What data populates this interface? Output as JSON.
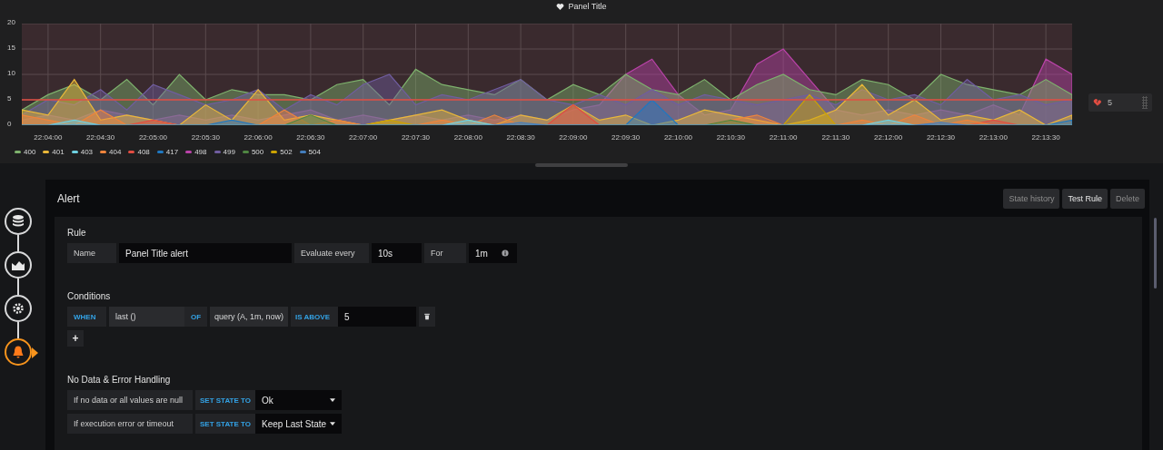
{
  "panel": {
    "title": "Panel Title",
    "chart_data": {
      "type": "area",
      "stacked": false,
      "grid": true,
      "legend": "bottom",
      "categories": [
        null,
        "22:04:00",
        null,
        "22:04:30",
        null,
        "22:05:00",
        null,
        "22:05:30",
        null,
        "22:06:00",
        null,
        "22:06:30",
        null,
        "22:07:00",
        null,
        "22:07:30",
        null,
        "22:08:00",
        null,
        "22:08:30",
        null,
        "22:09:00",
        null,
        "22:09:30",
        null,
        "22:10:00",
        null,
        "22:10:30",
        null,
        "22:11:00",
        null,
        "22:11:30",
        null,
        "22:12:00",
        null,
        "22:12:30",
        null,
        "22:13:00",
        null,
        "22:13:30",
        null
      ],
      "ylim": [
        0,
        20
      ],
      "yticks": [
        0,
        5,
        10,
        15,
        20
      ],
      "series": [
        {
          "name": "400",
          "color": "#7eb26d",
          "values": [
            3,
            6,
            8,
            5,
            9,
            4,
            10,
            5,
            7,
            6,
            6,
            5,
            8,
            9,
            4,
            11,
            8,
            7,
            6,
            9,
            5,
            8,
            6,
            10,
            7,
            6,
            9,
            5,
            8,
            10,
            7,
            6,
            9,
            8,
            5,
            10,
            8,
            7,
            6,
            9,
            6
          ]
        },
        {
          "name": "401",
          "color": "#eab839",
          "values": [
            3,
            2,
            9,
            1,
            2,
            1,
            0,
            4,
            1,
            7,
            1,
            2,
            1,
            0,
            1,
            2,
            3,
            1,
            0,
            2,
            1,
            4,
            1,
            2,
            0,
            1,
            3,
            2,
            1,
            0,
            1,
            3,
            8,
            2,
            5,
            1,
            2,
            1,
            3,
            0,
            2
          ]
        },
        {
          "name": "403",
          "color": "#6ed0e0",
          "values": [
            0,
            0,
            1,
            0,
            0,
            0,
            0,
            0,
            0,
            0,
            0,
            0,
            0,
            0,
            0,
            0,
            0,
            1,
            0,
            0,
            0,
            0,
            0,
            0,
            0,
            0,
            0,
            0,
            0,
            0,
            0,
            0,
            0,
            1,
            0,
            0,
            0,
            0,
            0,
            0,
            0
          ]
        },
        {
          "name": "404",
          "color": "#ef843c",
          "values": [
            2,
            1,
            0,
            3,
            0,
            0,
            0,
            0,
            0,
            0,
            3,
            0,
            1,
            0,
            0,
            0,
            1,
            0,
            2,
            0,
            0,
            0,
            0,
            0,
            0,
            0,
            0,
            1,
            2,
            0,
            0,
            0,
            1,
            0,
            2,
            0,
            1,
            0,
            0,
            0,
            0
          ]
        },
        {
          "name": "408",
          "color": "#e24d42",
          "values": [
            0,
            0,
            0,
            0,
            0,
            1,
            0,
            0,
            0,
            0,
            0,
            0,
            0,
            0,
            0,
            0,
            0,
            0,
            0,
            0,
            0,
            4,
            0,
            0,
            0,
            0,
            0,
            0,
            0,
            0,
            0,
            0,
            0,
            0,
            0,
            0,
            0,
            1,
            0,
            0,
            0
          ]
        },
        {
          "name": "417",
          "color": "#1f78c1",
          "values": [
            0,
            0,
            0,
            0,
            0,
            0,
            0,
            0,
            1,
            0,
            0,
            0,
            0,
            0,
            0,
            0,
            0,
            0,
            0,
            0,
            0,
            0,
            0,
            0,
            5,
            0,
            0,
            0,
            0,
            0,
            0,
            0,
            0,
            0,
            0,
            0,
            0,
            0,
            0,
            0,
            1
          ]
        },
        {
          "name": "498",
          "color": "#ba43a9",
          "values": [
            1,
            2,
            1,
            3,
            2,
            1,
            2,
            1,
            2,
            1,
            2,
            3,
            1,
            2,
            1,
            2,
            1,
            2,
            1,
            2,
            1,
            3,
            4,
            10,
            13,
            6,
            2,
            3,
            12,
            15,
            9,
            3,
            2,
            3,
            2,
            3,
            2,
            4,
            2,
            13,
            10
          ]
        },
        {
          "name": "499",
          "color": "#705da0",
          "values": [
            2,
            5,
            4,
            7,
            3,
            8,
            6,
            4,
            5,
            7,
            3,
            6,
            4,
            8,
            10,
            4,
            6,
            5,
            7,
            9,
            5,
            4,
            6,
            4,
            7,
            4,
            6,
            5,
            4,
            5,
            6,
            4,
            7,
            5,
            6,
            4,
            9,
            5,
            6,
            4,
            5
          ]
        },
        {
          "name": "500",
          "color": "#508642",
          "values": [
            0,
            0,
            0,
            0,
            0,
            0,
            0,
            0,
            0,
            0,
            0,
            2,
            0,
            0,
            0,
            0,
            0,
            0,
            0,
            0,
            0,
            0,
            0,
            0,
            0,
            0,
            0,
            1,
            0,
            0,
            0,
            0,
            0,
            0,
            0,
            0,
            0,
            0,
            0,
            0,
            0
          ]
        },
        {
          "name": "502",
          "color": "#cca300",
          "values": [
            0,
            0,
            0,
            0,
            0,
            0,
            0,
            0,
            0,
            0,
            0,
            0,
            0,
            0,
            1,
            0,
            0,
            0,
            0,
            0,
            0,
            0,
            0,
            0,
            0,
            0,
            0,
            0,
            0,
            0,
            6,
            0,
            0,
            0,
            0,
            0,
            0,
            0,
            0,
            0,
            0
          ]
        },
        {
          "name": "504",
          "color": "#447ebc",
          "values": [
            0,
            0,
            0,
            0,
            0,
            0,
            0,
            0,
            0,
            0,
            0,
            0,
            0,
            0,
            0,
            0,
            0,
            0,
            0,
            0.5,
            0,
            0,
            0,
            0,
            0,
            0,
            0,
            0,
            0,
            0,
            0,
            0,
            0,
            0,
            0,
            0.5,
            0,
            0,
            0,
            0,
            0
          ]
        }
      ],
      "ref_lines": [
        {
          "axis": "y",
          "value": 5,
          "color": "#e24d42"
        }
      ]
    },
    "threshold_value": "5"
  },
  "steps": [
    {
      "kind": "database",
      "selected": false
    },
    {
      "kind": "graph",
      "selected": false
    },
    {
      "kind": "settings",
      "selected": false
    },
    {
      "kind": "alert",
      "selected": true
    }
  ],
  "alert": {
    "title": "Alert",
    "buttons": [
      {
        "label": "State history",
        "disabled": true
      },
      {
        "label": "Test Rule",
        "disabled": false
      },
      {
        "label": "Delete",
        "disabled": true
      }
    ],
    "rule": {
      "heading": "Rule",
      "name_label": "Name",
      "name_value": "Panel Title alert",
      "evaluate_label": "Evaluate every",
      "evaluate_value": "10s",
      "for_label": "For",
      "for_value": "1m"
    },
    "conditions": {
      "heading": "Conditions",
      "when": "WHEN",
      "reducer": "last ()",
      "of": "OF",
      "query": "query (A, 1m, now)",
      "evaluator": "IS ABOVE",
      "threshold": "5",
      "add": "+"
    },
    "no_data": {
      "heading": "No Data & Error Handling",
      "rows": [
        {
          "label": "If no data or all values are null",
          "action": "SET STATE TO",
          "value": "Ok"
        },
        {
          "label": "If execution error or timeout",
          "action": "SET STATE TO",
          "value": "Keep Last State"
        }
      ]
    }
  }
}
